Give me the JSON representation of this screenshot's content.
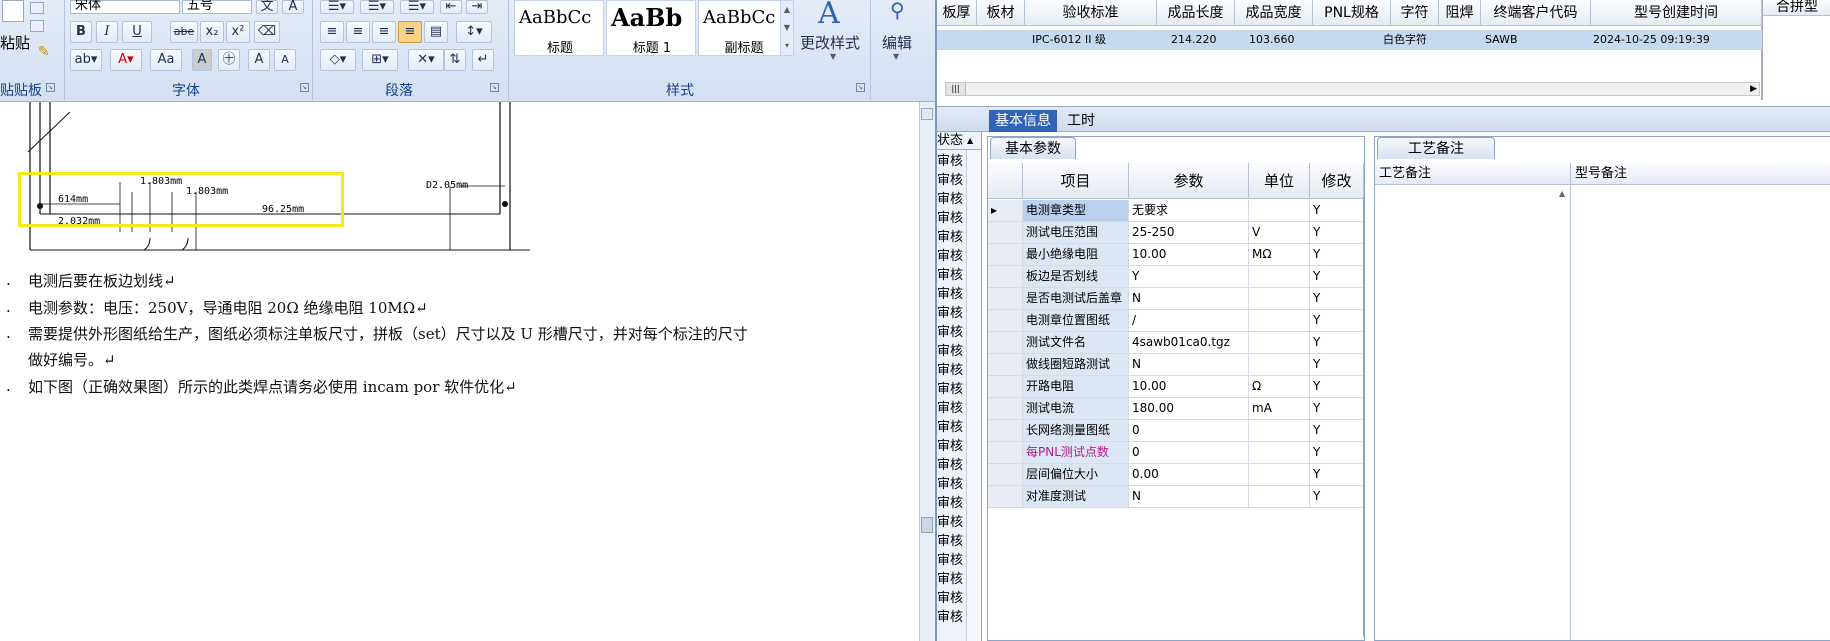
{
  "word": {
    "clipboard_label": "贴贴板",
    "paste_label": "粘贴",
    "font_name": "宋体",
    "font_size": "五号",
    "font_group_label": "字体",
    "paragraph_group_label": "段落",
    "styles_group_label": "样式",
    "bold": "B",
    "italic": "I",
    "underline": "U",
    "strike": "abe",
    "subscript": "x₂",
    "superscript": "x²",
    "grow_font": "A",
    "shrink_font": "A",
    "change_case": "Aa",
    "styles": [
      {
        "sample": "AaBbCc",
        "name": "标题"
      },
      {
        "sample": "AaBb",
        "name": "标题 1"
      },
      {
        "sample": "AaBbCc",
        "name": "副标题"
      }
    ],
    "change_styles_label": "更改样式",
    "edit_label": "编辑",
    "drawing": {
      "dim1": "1.803mm",
      "dim2": "1.803mm",
      "dim3": "614mm",
      "dim4": "2.032mm",
      "dim5": "96.25mm",
      "dim6": "D2.05mm"
    },
    "lines": [
      "电测后要在板边划线↵",
      "电测参数：电压：250V，导通电阻 20Ω   绝缘电阻 10MΩ↵",
      "需要提供外形图纸给生产，图纸必须标注单板尺寸，拼板（set）尺寸以及 U 形槽尺寸，并对每个标注的尺寸",
      "做好编号。↵",
      "如下图（正确效果图）所示的此类焊点请务必使用 incam por 软件优化↵"
    ]
  },
  "erp": {
    "top_headers": [
      "板厚",
      "板材",
      "验收标准",
      "成品长度",
      "成品宽度",
      "PNL规格",
      "字符",
      "阻焊",
      "终端客户代码",
      "型号创建时间",
      "合拼型"
    ],
    "top_row": [
      "IPC-6012 II 级",
      "214.220",
      "103.660",
      "白色字符",
      "SAWB",
      "2024-10-25 09:19:39"
    ],
    "tabs": [
      "基本信息",
      "工时"
    ],
    "status_header": "状态",
    "status_item": "审核",
    "params_tab": "基本参数",
    "notes_tab": "工艺备注",
    "param_headers": [
      "项目",
      "参数",
      "单位",
      "修改"
    ],
    "params": [
      {
        "item": "电测章类型",
        "value": "无要求",
        "unit": "",
        "mod": "Y"
      },
      {
        "item": "测试电压范围",
        "value": "25-250",
        "unit": "V",
        "mod": "Y"
      },
      {
        "item": "最小绝缘电阻",
        "value": "10.00",
        "unit": "MΩ",
        "mod": "Y"
      },
      {
        "item": "板边是否划线",
        "value": "Y",
        "unit": "",
        "mod": "Y"
      },
      {
        "item": "是否电测试后盖章",
        "value": "N",
        "unit": "",
        "mod": "Y"
      },
      {
        "item": "电测章位置图纸",
        "value": "/",
        "unit": "",
        "mod": "Y"
      },
      {
        "item": "测试文件名",
        "value": "4sawb01ca0.tgz",
        "unit": "",
        "mod": "Y"
      },
      {
        "item": "做线圈短路测试",
        "value": "N",
        "unit": "",
        "mod": "Y"
      },
      {
        "item": "开路电阻",
        "value": "10.00",
        "unit": "Ω",
        "mod": "Y"
      },
      {
        "item": "测试电流",
        "value": "180.00",
        "unit": "mA",
        "mod": "Y"
      },
      {
        "item": "长网络测量图纸",
        "value": "0",
        "unit": "",
        "mod": "Y"
      },
      {
        "item": "每PNL测试点数",
        "value": "0",
        "unit": "",
        "mod": "Y"
      },
      {
        "item": "层间偏位大小",
        "value": "0.00",
        "unit": "",
        "mod": "Y"
      },
      {
        "item": "对准度测试",
        "value": "N",
        "unit": "",
        "mod": "Y"
      }
    ],
    "notes_headers": [
      "工艺备注",
      "型号备注"
    ]
  }
}
